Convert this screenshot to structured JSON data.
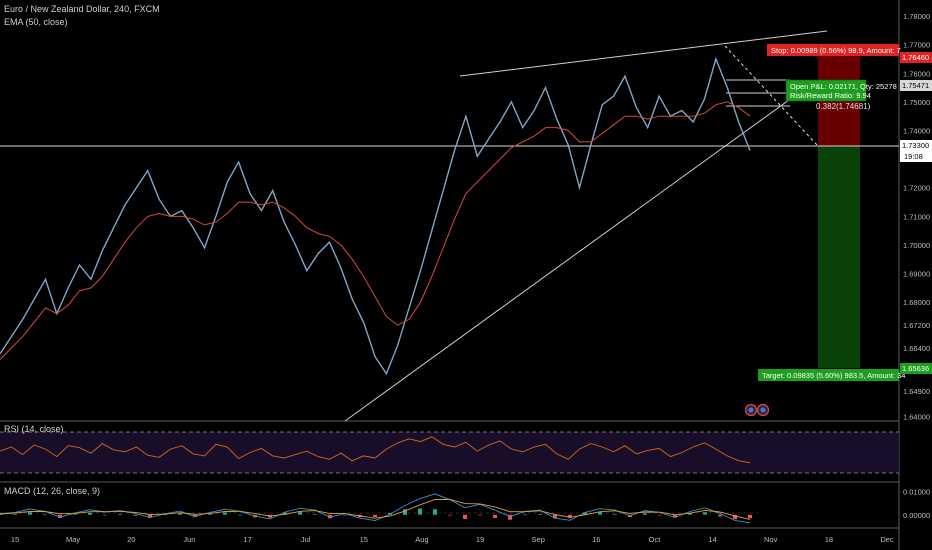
{
  "header": {
    "symbol_title": "Euro / New Zealand Dollar, 240, FXCM",
    "ema_label": "EMA (50, close)"
  },
  "panes": {
    "rsi_label": "RSI (14, close)",
    "macd_label": "MACD (12, 26, close, 9)"
  },
  "colors": {
    "background": "#000000",
    "candle": "#7fa7c9",
    "ema": "#d84a3a",
    "rsi": "#d2691e",
    "macd_line": "#3b8fd6",
    "signal_line": "#e0a040",
    "hist_up": "#26a69a",
    "hist_down": "#ef5350",
    "stop": "#e02424",
    "target": "#1e8e1e",
    "trendline": "#cfcfcf"
  },
  "chart_data": [
    {
      "type": "line",
      "pane": "price",
      "x": [
        "15",
        "May",
        "20",
        "Jun",
        "17",
        "Jul",
        "15",
        "Aug",
        "19",
        "Sep",
        "16",
        "Oct",
        "14",
        "Nov",
        "18",
        "Dec"
      ],
      "price_axis_ticks": [
        "1.78000",
        "1.77000",
        "1.76000",
        "1.75000",
        "1.74000",
        "1.73300",
        "1.72000",
        "1.71000",
        "1.70000",
        "1.69000",
        "1.68000",
        "1.67200",
        "1.66400",
        "1.65636",
        "1.64900",
        "1.64000"
      ],
      "ylim": [
        1.6385,
        1.7835
      ],
      "series": [
        {
          "values": [
            1.662,
            1.668,
            1.674,
            1.681,
            1.688,
            1.676,
            1.685,
            1.693,
            1.688,
            1.698,
            1.706,
            1.714,
            1.72,
            1.726,
            1.716,
            1.71,
            1.712,
            1.706,
            1.699,
            1.71,
            1.722,
            1.729,
            1.718,
            1.712,
            1.719,
            1.708,
            1.7,
            1.691,
            1.697,
            1.701,
            1.692,
            1.681,
            1.673,
            1.661,
            1.655,
            1.665,
            1.678,
            1.691,
            1.705,
            1.719,
            1.733,
            1.745,
            1.731,
            1.737,
            1.743,
            1.75,
            1.741,
            1.747,
            1.755,
            1.744,
            1.735,
            1.72,
            1.735,
            1.749,
            1.752,
            1.759,
            1.748,
            1.741,
            1.752,
            1.745,
            1.747,
            1.743,
            1.751,
            1.765,
            1.755,
            1.743,
            1.733
          ]
        },
        {
          "values": [
            1.66,
            1.664,
            1.668,
            1.673,
            1.678,
            1.676,
            1.679,
            1.684,
            1.685,
            1.689,
            1.695,
            1.701,
            1.706,
            1.71,
            1.711,
            1.71,
            1.71,
            1.709,
            1.707,
            1.708,
            1.711,
            1.715,
            1.715,
            1.714,
            1.715,
            1.713,
            1.71,
            1.706,
            1.704,
            1.703,
            1.7,
            1.695,
            1.689,
            1.682,
            1.675,
            1.672,
            1.674,
            1.68,
            1.689,
            1.699,
            1.709,
            1.718,
            1.722,
            1.726,
            1.73,
            1.734,
            1.736,
            1.738,
            1.741,
            1.741,
            1.74,
            1.736,
            1.736,
            1.739,
            1.742,
            1.745,
            1.745,
            1.744,
            1.745,
            1.745,
            1.745,
            1.745,
            1.746,
            1.749,
            1.75,
            1.748,
            1.745
          ]
        }
      ]
    },
    {
      "type": "line",
      "pane": "rsi",
      "ylim": [
        20,
        80
      ],
      "series": [
        {
          "values": [
            52,
            58,
            47,
            61,
            55,
            44,
            60,
            57,
            49,
            63,
            54,
            51,
            58,
            46,
            43,
            55,
            60,
            48,
            45,
            62,
            58,
            41,
            50,
            56,
            45,
            42,
            47,
            52,
            44,
            40,
            49,
            38,
            45,
            42,
            55,
            64,
            70,
            66,
            73,
            62,
            58,
            65,
            52,
            61,
            67,
            55,
            51,
            58,
            62,
            48,
            40,
            55,
            63,
            58,
            51,
            60,
            48,
            53,
            56,
            44,
            50,
            58,
            64,
            55,
            45,
            38,
            35
          ]
        }
      ]
    },
    {
      "type": "line",
      "pane": "macd",
      "ylim": [
        -0.004,
        0.012
      ],
      "series": [
        {
          "values": [
            0.0005,
            0.001,
            0.0025,
            0.0015,
            -0.001,
            0.0008,
            0.0022,
            0.0012,
            0.0018,
            0.0006,
            -0.0012,
            0.0004,
            0.0016,
            -0.0008,
            0.001,
            0.0024,
            0.0015,
            -0.0006,
            -0.0018,
            0.0012,
            0.0028,
            0.002,
            -0.001,
            0.0005,
            -0.0015,
            -0.0025,
            0.0002,
            0.004,
            0.007,
            0.009,
            0.0065,
            0.003,
            0.0045,
            0.002,
            -0.0008,
            0.0014,
            0.002,
            -0.0015,
            -0.0024,
            0.001,
            0.0026,
            0.002,
            -0.0004,
            0.0018,
            0.001,
            -0.0012,
            0.0014,
            0.003,
            0.0005,
            -0.0025,
            -0.0035
          ]
        },
        {
          "values": [
            0.0003,
            0.0007,
            0.0014,
            0.0014,
            0.0004,
            0.0006,
            0.0013,
            0.0013,
            0.0015,
            0.001,
            0.0001,
            0.0003,
            0.0009,
            0.0002,
            0.0006,
            0.0014,
            0.0015,
            0.0005,
            -0.0006,
            0.0002,
            0.0015,
            0.0018,
            0.0005,
            0.0005,
            -0.0005,
            -0.0015,
            -0.0006,
            0.0016,
            0.0043,
            0.0066,
            0.0066,
            0.0048,
            0.0047,
            0.0034,
            0.0013,
            0.0013,
            0.0017,
            0.0001,
            -0.0011,
            0,
            0.0013,
            0.0017,
            0.0006,
            0.0012,
            0.0011,
            0,
            0.0007,
            0.0019,
            0.0012,
            -0.0006,
            -0.002
          ]
        }
      ],
      "axis_ticks": [
        "0.01000",
        "0.00000"
      ]
    }
  ],
  "markers": {
    "current_price": "1.73300",
    "countdown": "19:08",
    "stop_price": "1.76460",
    "position_price": "1.75471",
    "target_price": "1.65636"
  },
  "position_tool": {
    "stop_label": "Stop: 0.00989 (0.56%) 98.9, Amount: 7",
    "pnl_label": "Open P&L: 0.02171, Qty: 25278",
    "ratio_label": "Risk/Reward Ratio: 9.94",
    "target_label": "Target: 0.09835 (5.60%) 983.5, Amount: 34",
    "fib_label": "0.382(1.74681)"
  }
}
